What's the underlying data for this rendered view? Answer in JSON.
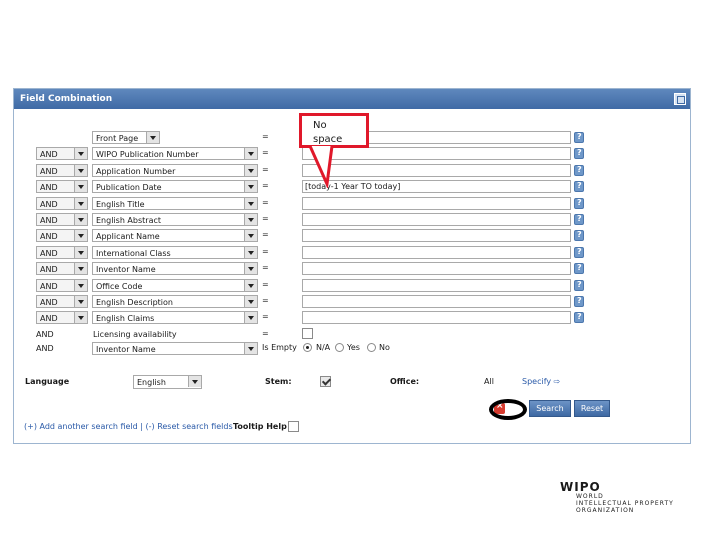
{
  "panel": {
    "title": "Field Combination",
    "icon": "window-icon"
  },
  "rows": [
    {
      "op": "",
      "field": "Front Page",
      "relation": "=",
      "value": "",
      "kind": "input-short"
    },
    {
      "op": "AND",
      "field": "WIPO Publication Number",
      "relation": "=",
      "value": "",
      "kind": "input"
    },
    {
      "op": "AND",
      "field": "Application Number",
      "relation": "=",
      "value": "",
      "kind": "input"
    },
    {
      "op": "AND",
      "field": "Publication Date",
      "relation": "=",
      "value": "[today-1 Year TO today]",
      "kind": "input"
    },
    {
      "op": "AND",
      "field": "English Title",
      "relation": "=",
      "value": "",
      "kind": "input"
    },
    {
      "op": "AND",
      "field": "English Abstract",
      "relation": "=",
      "value": "",
      "kind": "input"
    },
    {
      "op": "AND",
      "field": "Applicant Name",
      "relation": "=",
      "value": "",
      "kind": "input"
    },
    {
      "op": "AND",
      "field": "International Class",
      "relation": "=",
      "value": "",
      "kind": "input"
    },
    {
      "op": "AND",
      "field": "Inventor Name",
      "relation": "=",
      "value": "",
      "kind": "input"
    },
    {
      "op": "AND",
      "field": "Office Code",
      "relation": "=",
      "value": "",
      "kind": "input"
    },
    {
      "op": "AND",
      "field": "English Description",
      "relation": "=",
      "value": "",
      "kind": "input"
    },
    {
      "op": "AND",
      "field": "English Claims",
      "relation": "=",
      "value": "",
      "kind": "input"
    }
  ],
  "licensing_row": {
    "op": "AND",
    "field": "Licensing availability",
    "relation": "="
  },
  "inventor_row": {
    "op": "AND",
    "field": "Inventor Name",
    "relation": "Is Empty",
    "options": [
      "N/A",
      "Yes",
      "No"
    ],
    "selected": "N/A"
  },
  "language": {
    "label": "Language",
    "value": "English"
  },
  "stem": {
    "label": "Stem:",
    "checked": true
  },
  "office": {
    "label": "Office:",
    "value": "All",
    "specify_label": "Specify ⇨"
  },
  "buttons": {
    "search": "Search",
    "reset": "Reset"
  },
  "links": {
    "add": "(+) Add another search field",
    "separator": " | ",
    "reset": "(-) Reset search fields"
  },
  "tooltip_help": {
    "label": "Tooltip Help"
  },
  "callout": {
    "line1": "No",
    "line2": "space"
  },
  "logo": {
    "mark": "WIPO",
    "line1": "WORLD",
    "line2": "INTELLECTUAL PROPERTY",
    "line3": "ORGANIZATION"
  },
  "colors": {
    "header": "#4a76b0",
    "callout_border": "#e0182a",
    "link": "#2a5aa8"
  }
}
